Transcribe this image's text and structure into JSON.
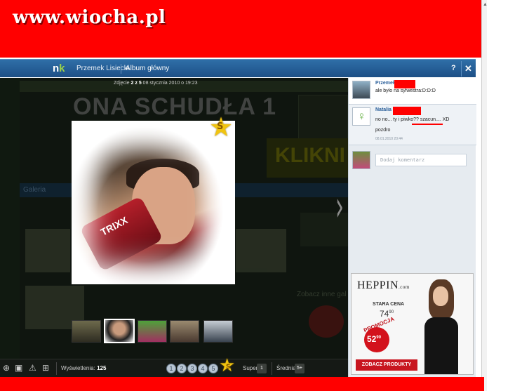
{
  "watermark": {
    "text": "www.wiocha.pl"
  },
  "header": {
    "logo_n": "n",
    "logo_k": "k",
    "user_link": "Przemek Lisiecki",
    "album_link": "Album główny",
    "help": "?",
    "close": "✕"
  },
  "photo_info": {
    "label": "Zdjęcie",
    "position": "2 z 5",
    "date": "08 stycznia 2010 o 19:23"
  },
  "background_page": {
    "headline": "ONA SCHUDŁA 1",
    "banner_word": "KLIKNI",
    "gallery_tab": "Galeria",
    "side_heading": "Zobacz inne gal"
  },
  "photo": {
    "can_text": "TRIXX",
    "badge_letter": "S"
  },
  "toolbar": {
    "views_label": "Wyświetlenia:",
    "views_value": "125",
    "star_values": [
      "1",
      "2",
      "3",
      "4",
      "5"
    ],
    "super_star": "S",
    "super_label": "Super",
    "super_count": "1",
    "avg_label": "Średnia:",
    "avg_value": "5+"
  },
  "comments": [
    {
      "name": "Przemek",
      "text": "ale było na sylwestra:D:D:D",
      "date": ""
    },
    {
      "name": "Natalia",
      "text": "no no... ty i piwko?? szacun.... XD",
      "text2": "pozdro",
      "date": "08.01.2010 20:44"
    }
  ],
  "add_comment": {
    "placeholder": "Dodaj komentarz"
  },
  "ad": {
    "brand": "HEPPIN",
    "brand_suffix": ".com",
    "old_price_label": "STARA CENA",
    "old_price": "74",
    "old_price_cents": "90",
    "promo_label": "PROMOCJA",
    "new_price": "52",
    "new_price_cents": "90",
    "button": "ZOBACZ PRODUKTY"
  },
  "colors": {
    "watermark_band": "#ff0000",
    "nk_bar": "#2f6fa8",
    "link": "#2a5f9a",
    "ad_red": "#c8151f"
  }
}
